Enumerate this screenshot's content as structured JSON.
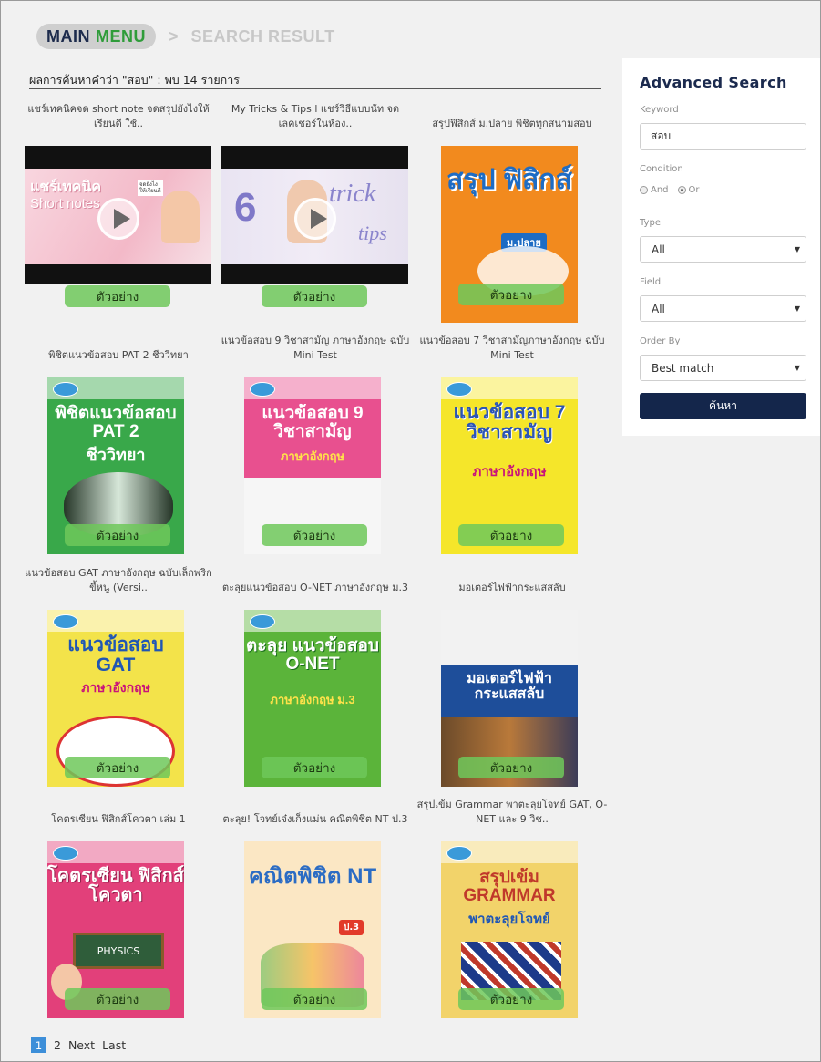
{
  "breadcrumb": {
    "main_1": "MAIN",
    "main_2": "MENU",
    "separator": ">",
    "current": "SEARCH RESULT"
  },
  "results": {
    "summary": "ผลการค้นหาคำว่า \"สอบ\" : พบ 14 รายการ"
  },
  "preview_label": "ตัวอย่าง",
  "items": [
    {
      "title": "แชร์เทคนิคจด short note จดสรุปยังไงให้เรียนดี ใช้..",
      "kind": "video",
      "thumb_text_1": "แชร์เทคนิค",
      "thumb_text_2": "Short notes",
      "thumb_tag": "จดยังไง ให้เรียนดี"
    },
    {
      "title": "My Tricks & Tips l แชร์วิธีแบบนัท จดเลคเชอร์ในห้อง..",
      "kind": "video",
      "thumb_text_1": "6",
      "thumb_text_2": "trick",
      "thumb_tag": "tips"
    },
    {
      "title": "สรุปฟิสิกส์ ม.ปลาย พิชิตทุกสนามสอบ",
      "kind": "book",
      "cover_text": "สรุป ฟิสิกส์",
      "cover_sub": "ม.ปลาย",
      "bg": "#f28a1e",
      "fg": "#1e6cc4"
    },
    {
      "title": "พิชิตแนวข้อสอบ PAT 2 ชีววิทยา",
      "kind": "book",
      "cover_text": "พิชิตแนวข้อสอบ PAT 2",
      "cover_sub": "ชีววิทยา",
      "bg": "#39a84a",
      "fg": "#ffffff"
    },
    {
      "title": "แนวข้อสอบ 9 วิชาสามัญ ภาษาอังกฤษ ฉบับ Mini Test",
      "kind": "book",
      "cover_text": "แนวข้อสอบ 9 วิชาสามัญ",
      "cover_sub": "ภาษาอังกฤษ",
      "bg": "#e8508f",
      "fg": "#ffffff"
    },
    {
      "title": "แนวข้อสอบ 7 วิชาสามัญภาษาอังกฤษ ฉบับ Mini Test",
      "kind": "book",
      "cover_text": "แนวข้อสอบ 7 วิชาสามัญ",
      "cover_sub": "ภาษาอังกฤษ",
      "bg": "#f5e62a",
      "fg": "#2b54b5"
    },
    {
      "title": "แนวข้อสอบ GAT ภาษาอังกฤษ ฉบับเล็กพริกขี้หนู (Versi..",
      "kind": "book",
      "cover_text": "แนวข้อสอบ GAT",
      "cover_sub": "ภาษาอังกฤษ",
      "bg": "#f3e34a",
      "fg": "#1f56b5"
    },
    {
      "title": "ตะลุยแนวข้อสอบ O-NET ภาษาอังกฤษ ม.3",
      "kind": "book",
      "cover_text": "ตะลุย แนวข้อสอบ O-NET",
      "cover_sub": "ภาษาอังกฤษ ม.3",
      "bg": "#5bb43a",
      "fg": "#ffffff"
    },
    {
      "title": "มอเตอร์ไฟฟ้ากระแสสลับ",
      "kind": "book",
      "cover_text": "มอเตอร์ไฟฟ้า กระแสสลับ",
      "cover_sub": "",
      "bg": "#1e4e9a",
      "fg": "#ffffff"
    },
    {
      "title": "โคตรเซียน ฟิสิกส์โควตา เล่ม 1",
      "kind": "book",
      "cover_text": "โคตรเซียน ฟิสิกส์โควตา",
      "cover_sub": "PHYSICS",
      "bg": "#e2407a",
      "fg": "#ffffff"
    },
    {
      "title": "ตะลุย! โจทย์เจ๋งเก็งแม่น คณิตพิชิต NT ป.3",
      "kind": "book",
      "cover_text": "คณิตพิชิต NT",
      "cover_sub": "ป.3",
      "bg": "#fbe7c4",
      "fg": "#e23a2a"
    },
    {
      "title": "สรุปเข้ม Grammar พาตะลุยโจทย์ GAT, O-NET และ 9 วิช..",
      "kind": "book",
      "cover_text": "สรุปเข้ม GRAMMAR",
      "cover_sub": "พาตะลุยโจทย์",
      "bg": "#f2d36a",
      "fg": "#c0392b"
    }
  ],
  "pagination": {
    "current": "1",
    "page2": "2",
    "next": "Next",
    "last": "Last"
  },
  "advanced_search": {
    "title": "Advanced Search",
    "keyword_label": "Keyword",
    "keyword_value": "สอบ",
    "condition_label": "Condition",
    "and_label": "And",
    "or_label": "Or",
    "type_label": "Type",
    "type_value": "All",
    "field_label": "Field",
    "field_value": "All",
    "order_label": "Order By",
    "order_value": "Best match",
    "submit_label": "ค้นหา",
    "caret": "▼"
  },
  "colors": {
    "navy": "#14264b",
    "green": "#2f9c3a",
    "preview_green": "#6ec85a",
    "page_blue": "#3d8fd9"
  }
}
